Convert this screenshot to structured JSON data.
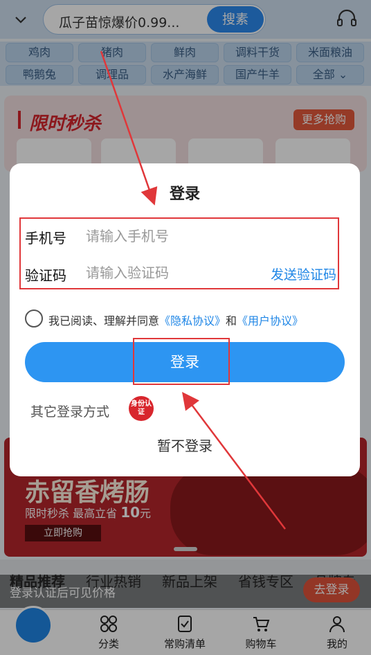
{
  "header": {
    "search_text": "瓜子苗惊爆价0.99...",
    "search_button": "搜素"
  },
  "categories": [
    "鸡肉",
    "猪肉",
    "鲜肉",
    "调料干货",
    "米面粮油",
    "鸭鹅兔",
    "调理品",
    "水产海鲜",
    "国产牛羊",
    "全部"
  ],
  "flash_sale": {
    "title": "限时秒杀",
    "more": "更多抢购"
  },
  "banner": {
    "title": "赤留香烤肠",
    "subtitle": "限时秒杀 最高立省",
    "amount": "10",
    "unit": "元",
    "button": "立即抢购"
  },
  "section_tabs": [
    "精品推荐",
    "行业热销",
    "新品上架",
    "省钱专区",
    "品牌专"
  ],
  "price_bar": {
    "text": "登录认证后可见价格",
    "button": "去登录"
  },
  "bottom_nav": [
    "分类",
    "常购清单",
    "购物车",
    "我的"
  ],
  "dialog": {
    "title": "登录",
    "phone_label": "手机号",
    "phone_placeholder": "请输入手机号",
    "code_label": "验证码",
    "code_placeholder": "请输入验证码",
    "send_code": "发送验证码",
    "agree_prefix": "我已阅读、理解并同意",
    "privacy": "《隐私协议》",
    "and": "和",
    "user_agreement": "《用户协议》",
    "login_button": "登录",
    "other_login": "其它登录方式",
    "id_badge": "身份认证",
    "skip": "暂不登录"
  },
  "colors": {
    "primary": "#2d95f2",
    "link": "#1f86e6",
    "annotation": "#e0373a",
    "flash_red": "#d8262d"
  }
}
